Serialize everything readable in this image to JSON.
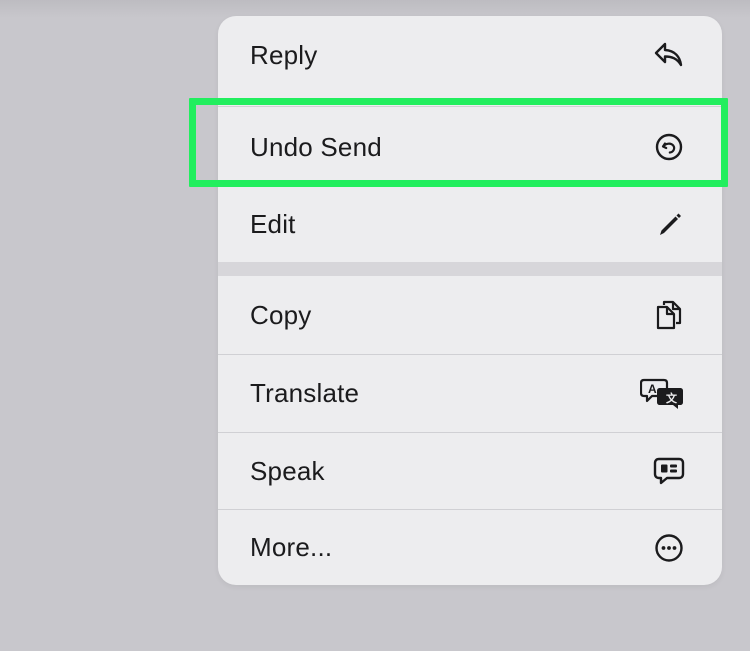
{
  "menu": {
    "items": [
      {
        "label": "Reply",
        "icon": "reply-icon"
      },
      {
        "label": "Undo Send",
        "icon": "undo-send-icon"
      },
      {
        "label": "Edit",
        "icon": "pencil-icon"
      },
      {
        "label": "Copy",
        "icon": "copy-icon"
      },
      {
        "label": "Translate",
        "icon": "translate-icon"
      },
      {
        "label": "Speak",
        "icon": "speech-bubble-icon"
      },
      {
        "label": "More...",
        "icon": "ellipsis-circle-icon"
      }
    ]
  },
  "colors": {
    "highlight": "#22ee5e",
    "menu_background": "#ededef",
    "backdrop": "#c8c7cc",
    "text": "#1b1b1d"
  }
}
